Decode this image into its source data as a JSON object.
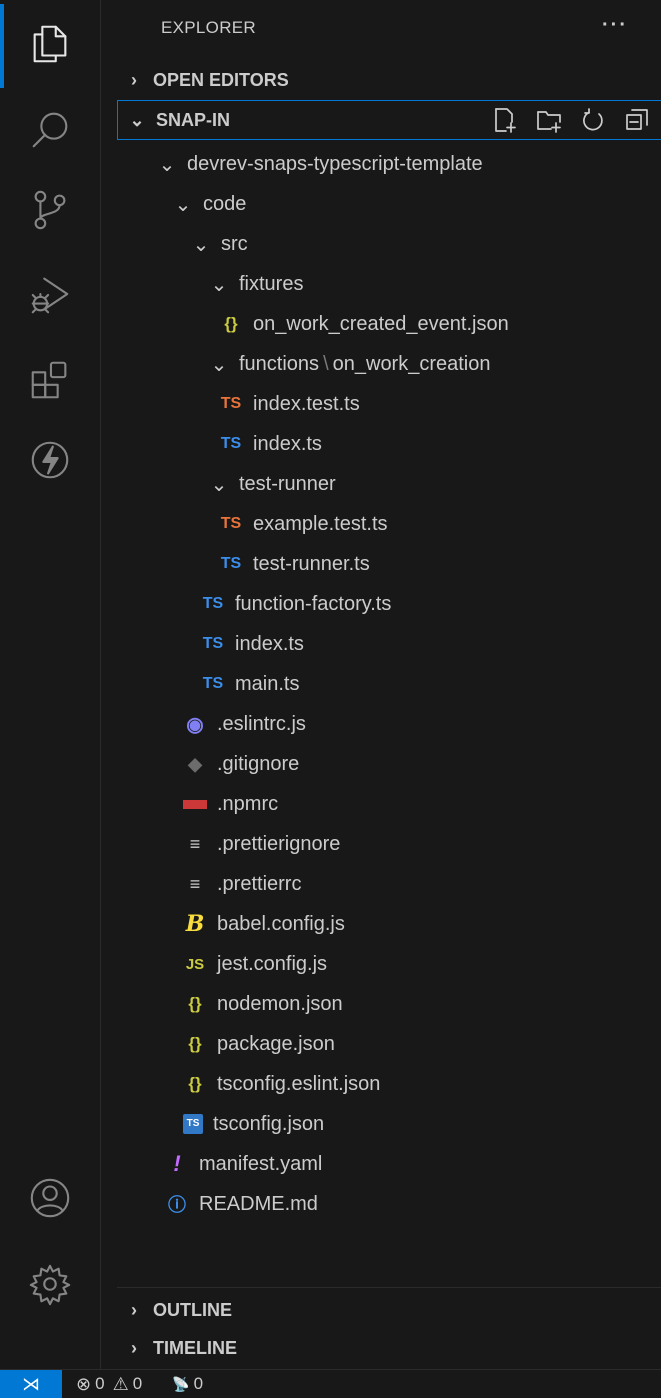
{
  "explorer": {
    "title": "EXPLORER",
    "more": "···"
  },
  "sections": {
    "open_editors": "OPEN EDITORS",
    "snap_in": "SNAP-IN",
    "outline": "OUTLINE",
    "timeline": "TIMELINE"
  },
  "chevrons": {
    "collapsed": "›",
    "expanded": "⌄"
  },
  "tree": {
    "root": "devrev-snaps-typescript-template",
    "code": "code",
    "src": "src",
    "fixtures": "fixtures",
    "fixture_file": "on_work_created_event.json",
    "functions_a": "functions",
    "functions_sep": "\\",
    "functions_b": "on_work_creation",
    "index_test": "index.test.ts",
    "index_ts": "index.ts",
    "test_runner_dir": "test-runner",
    "example_test": "example.test.ts",
    "test_runner_ts": "test-runner.ts",
    "function_factory": "function-factory.ts",
    "src_index": "index.ts",
    "main": "main.ts",
    "eslintrc": ".eslintrc.js",
    "gitignore": ".gitignore",
    "npmrc": ".npmrc",
    "prettierignore": ".prettierignore",
    "prettierrc": ".prettierrc",
    "babel": "babel.config.js",
    "jest": "jest.config.js",
    "nodemon": "nodemon.json",
    "package": "package.json",
    "tsconfig_eslint": "tsconfig.eslint.json",
    "tsconfig": "tsconfig.json",
    "manifest": "manifest.yaml",
    "readme": "README.md"
  },
  "icons": {
    "ts": "TS",
    "js": "JS",
    "json": "{}",
    "babel": "B",
    "yaml": "!",
    "info": "ⓘ",
    "lines": "≡",
    "eslint": "◉",
    "git": "◆",
    "tsconfig": "TS"
  },
  "status": {
    "remote": "⋊",
    "errors_sym": "⊗",
    "errors": "0",
    "warnings_sym": "⚠",
    "warnings": "0",
    "ports_sym": "📡",
    "ports": "0"
  },
  "colors": {
    "accent": "#0078d4",
    "ts_blue": "#3b8eea",
    "ts_orange": "#e8743b",
    "json_yellow": "#cbcb41"
  }
}
